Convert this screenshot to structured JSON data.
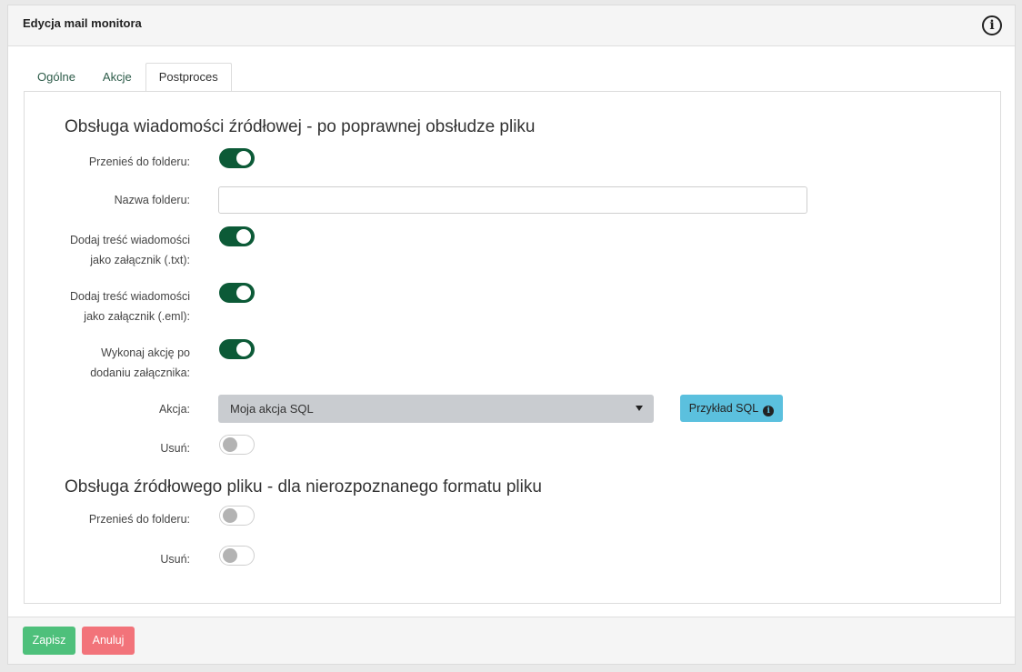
{
  "header": {
    "title": "Edycja mail monitora",
    "info_icon": "info-circle-icon"
  },
  "tabs": [
    {
      "label": "Ogólne",
      "active": false
    },
    {
      "label": "Akcje",
      "active": false
    },
    {
      "label": "Postproces",
      "active": true
    }
  ],
  "section1": {
    "heading": "Obsługa wiadomości źródłowej - po poprawnej obsłudze pliku",
    "move_to_folder": {
      "label": "Przenieś do folderu:",
      "on": true
    },
    "folder_name": {
      "label": "Nazwa folderu:",
      "value": ""
    },
    "add_txt": {
      "label_line1": "Dodaj treść wiadomości",
      "label_line2": "jako załącznik (.txt):",
      "on": true
    },
    "add_eml": {
      "label_line1": "Dodaj treść wiadomości",
      "label_line2": "jako załącznik (.eml):",
      "on": true
    },
    "run_action": {
      "label_line1": "Wykonaj akcję po",
      "label_line2": "dodaniu załącznika:",
      "on": true
    },
    "action": {
      "label": "Akcja:",
      "selected": "Moja akcja SQL"
    },
    "sql_example_button": {
      "label": "Przykład SQL",
      "icon": "info-circle-icon"
    },
    "delete": {
      "label": "Usuń:",
      "on": false
    }
  },
  "section2": {
    "heading": "Obsługa źródłowego pliku - dla nierozpoznanego formatu pliku",
    "move_to_folder": {
      "label": "Przenieś do folderu:",
      "on": false
    },
    "delete": {
      "label": "Usuń:",
      "on": false
    }
  },
  "footer": {
    "save_label": "Zapisz",
    "cancel_label": "Anuluj"
  },
  "colors": {
    "toggle_on": "#0c5a37",
    "save": "#4ec07b",
    "cancel": "#f2737a",
    "sql_button": "#5bc0de",
    "select_bg": "#c9ccd0"
  }
}
